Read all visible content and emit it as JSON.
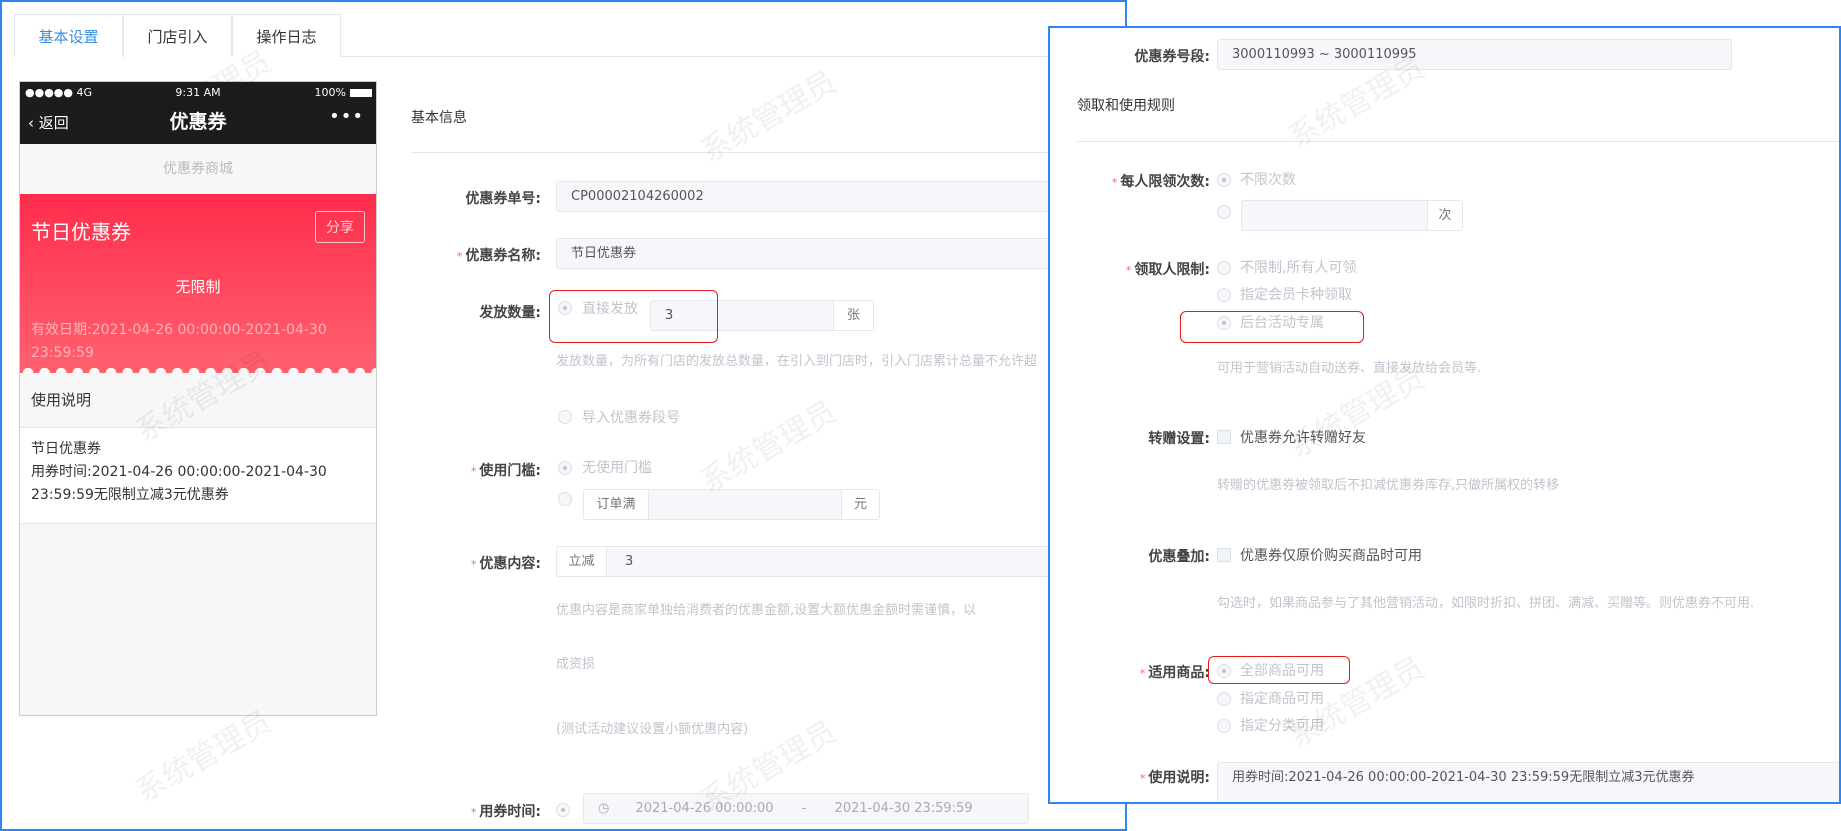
{
  "tabs": [
    "基本设置",
    "门店引入",
    "操作日志"
  ],
  "watermark": "系统管理员",
  "phone": {
    "carrier": "●●●●● 4G",
    "time": "9:31 AM",
    "battery": "100%",
    "back": "返回",
    "title": "优惠券",
    "more": "•••",
    "mall": "优惠券商城",
    "card_name": "节日优惠券",
    "share": "分享",
    "limit": "无限制",
    "valid": "有效日期:2021-04-26 00:00:00-2021-04-30 23:59:59",
    "usage_title": "使用说明",
    "usage_name": "节日优惠券",
    "usage_text": "用券时间:2021-04-26 00:00:00-2021-04-30 23:59:59无限制立减3元优惠券"
  },
  "form": {
    "section": "基本信息",
    "code_label": "优惠券单号:",
    "code": "CP00002104260002",
    "name_label": "优惠券名称:",
    "name": "节日优惠券",
    "qty_label": "发放数量:",
    "qty_option": "直接发放",
    "qty": "3",
    "qty_unit": "张",
    "qty_hint": "发放数量，为所有门店的发放总数量，在引入到门店时，引入门店累计总量不允许超",
    "import_option": "导入优惠券段号",
    "threshold_label": "使用门槛:",
    "threshold_none": "无使用门槛",
    "threshold_prefix": "订单满",
    "threshold_unit": "元",
    "content_label": "优惠内容:",
    "content_prefix": "立减",
    "content_value": "3",
    "content_hint1": "优惠内容是商家单独给消费者的优惠金额,设置大额优惠金额时需谨慎，以",
    "content_hint2": "成资损",
    "content_hint3": "(测试活动建议设置小额优惠内容)",
    "time_label": "用券时间:",
    "time_start": "2021-04-26 00:00:00",
    "time_sep": "-",
    "time_end": "2021-04-30 23:59:59"
  },
  "rules": {
    "segment_label": "优惠券号段:",
    "segment": "3000110993 ~ 3000110995",
    "section": "领取和使用规则",
    "per_person_label": "每人限领次数:",
    "per_person_unlimited": "不限次数",
    "per_person_unit": "次",
    "receiver_label": "领取人限制:",
    "receiver_options": [
      "不限制,所有人可领",
      "指定会员卡种领取",
      "后台活动专属"
    ],
    "receiver_hint": "可用于营销活动自动送券、直接发放给会员等.",
    "gift_label": "转赠设置:",
    "gift_option": "优惠券允许转赠好友",
    "gift_hint": "转赠的优惠券被领取后不扣减优惠券库存,只做所属权的转移",
    "stack_label": "优惠叠加:",
    "stack_option": "优惠券仅原价购买商品时可用",
    "stack_hint": "勾选时，如果商品参与了其他营销活动，如限时折扣、拼团、满减、买赠等。则优惠券不可用.",
    "goods_label": "适用商品:",
    "goods_options": [
      "全部商品可用",
      "指定商品可用",
      "指定分类可用"
    ],
    "desc_label": "使用说明:",
    "desc": "用券时间:2021-04-26 00:00:00-2021-04-30 23:59:59无限制立减3元优惠券"
  },
  "colors": {
    "accent": "#2f86f0",
    "tab_active": "#3a8ee6",
    "coupon_red": "#ff2d4b",
    "highlight": "#e81c1c"
  }
}
